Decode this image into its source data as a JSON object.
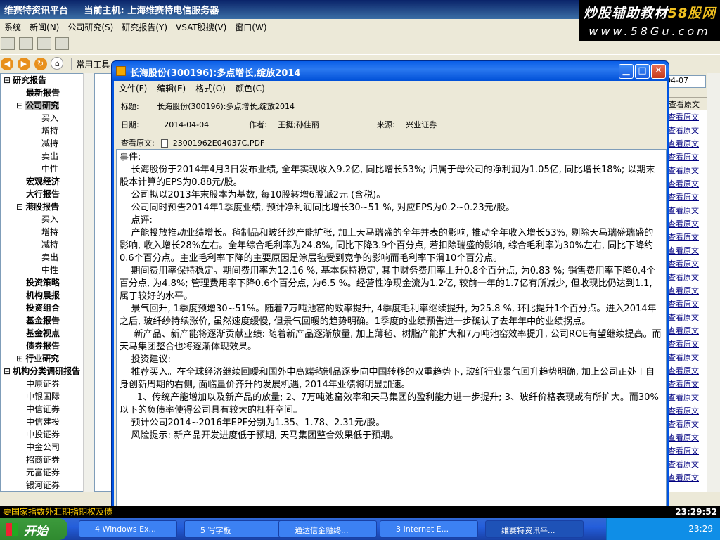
{
  "app": {
    "title": "维赛特资讯平台",
    "host_label": "当前主机: 上海维赛特电信服务器"
  },
  "logo": {
    "line1": "炒股辅助教材",
    "line1_accent": "58股网",
    "line2": "www.58Gu.com"
  },
  "menu": [
    "系统",
    "新闻(N)",
    "公司研究(S)",
    "研究报告(Y)",
    "VSAT股搜(V)",
    "窗口(W)"
  ],
  "toolbar2": {
    "common_tools": "常用工具"
  },
  "tree": [
    {
      "label": "研究报告",
      "level": 0,
      "bold": true,
      "expander": "⊟"
    },
    {
      "label": "最新报告",
      "level": 1,
      "bold": true
    },
    {
      "label": "公司研究",
      "level": 1,
      "bold": true,
      "expander": "⊟",
      "selected": true
    },
    {
      "label": "买入",
      "level": 2
    },
    {
      "label": "增持",
      "level": 2
    },
    {
      "label": "减持",
      "level": 2
    },
    {
      "label": "卖出",
      "level": 2
    },
    {
      "label": "中性",
      "level": 2
    },
    {
      "label": "宏观经济",
      "level": 1,
      "bold": true
    },
    {
      "label": "大行报告",
      "level": 1,
      "bold": true
    },
    {
      "label": "港股报告",
      "level": 1,
      "bold": true,
      "expander": "⊟"
    },
    {
      "label": "买入",
      "level": 2
    },
    {
      "label": "增持",
      "level": 2
    },
    {
      "label": "减持",
      "level": 2
    },
    {
      "label": "卖出",
      "level": 2
    },
    {
      "label": "中性",
      "level": 2
    },
    {
      "label": "投资策略",
      "level": 1,
      "bold": true
    },
    {
      "label": "机构晨报",
      "level": 1,
      "bold": true
    },
    {
      "label": "投资组合",
      "level": 1,
      "bold": true
    },
    {
      "label": "基金报告",
      "level": 1,
      "bold": true
    },
    {
      "label": "基金视点",
      "level": 1,
      "bold": true
    },
    {
      "label": "债券报告",
      "level": 1,
      "bold": true
    },
    {
      "label": "行业研究",
      "level": 1,
      "bold": true,
      "expander": "⊞"
    },
    {
      "label": "机构分类调研报告",
      "level": 0,
      "bold": true,
      "expander": "⊟"
    },
    {
      "label": "中原证券",
      "level": 1
    },
    {
      "label": "中银国际",
      "level": 1
    },
    {
      "label": "中信证券",
      "level": 1
    },
    {
      "label": "中信建投",
      "level": 1
    },
    {
      "label": "中投证券",
      "level": 1
    },
    {
      "label": "中金公司",
      "level": 1
    },
    {
      "label": "招商证券",
      "level": 1
    },
    {
      "label": "元富证券",
      "level": 1
    },
    {
      "label": "银河证券",
      "level": 1
    }
  ],
  "list": {
    "date": "04-07",
    "header": "查看原文",
    "link": "查看原文",
    "rows": 30
  },
  "dialog": {
    "title": "长海股份(300196):多点增长,绽放2014",
    "menu": [
      "文件(F)",
      "编辑(E)",
      "格式(O)",
      "颜色(C)"
    ],
    "meta": {
      "title_label": "标题:",
      "title_value": "长海股份(300196):多点增长,绽放2014",
      "date_label": "日期:",
      "date_value": "2014-04-04",
      "author_label": "作者:",
      "author_value": "王挺;孙佳丽",
      "source_label": "来源:",
      "source_value": "兴业证券",
      "original_label": "查看原文:",
      "original_file": "23001962E04037C.PDF"
    },
    "content": [
      "事件:",
      "    长海股份于2014年4月3日发布业绩, 全年实现收入9.2亿, 同比增长53%; 归属于母公司的净利润为1.05亿, 同比增长18%; 以期末股本计算的EPS为0.88元/股。",
      "    公司拟以2013年末股本为基数, 每10股转增6股派2元 (含税)。",
      "    公司同时预告2014年1季度业绩, 预计净利润同比增长30~51 %, 对应EPS为0.2~0.23元/股。",
      "    点评:",
      "    产能投放推动业绩增长。毡制品和玻纤纱产能扩张, 加上天马瑞盛的全年并表的影响, 推动全年收入增长53%, 剔除天马瑞盛瑞盛的影响, 收入增长28%左右。全年综合毛利率为24.8%, 同比下降3.9个百分点, 若扣除瑞盛的影响, 综合毛利率为30%左右, 同比下降约0.6个百分点。主业毛利率下降的主要原因是涂层毡受到竞争的影响而毛利率下滑10个百分点。",
      "    期间费用率保持稳定。期间费用率为12.16 %, 基本保持稳定, 其中财务费用率上升0.8个百分点, 为0.83 %; 销售费用率下降0.4个百分点, 为4.8%; 管理费用率下降0.6个百分点, 为6.5 %。经营性净现金流为1.2亿, 较前一年的1.7亿有所减少, 但收现比仍达到1.1, 属于较好的水平。",
      "    景气回升, 1季度预增30~51%。随着7万吨池窑的效率提升, 4季度毛利率继续提升, 为25.8 %, 环比提升1个百分点。进入2014年之后, 玻纤纱持续涨价, 虽然速度缓慢, 但景气回暖的趋势明确。1季度的业绩预告进一步确认了去年年中的业绩拐点。",
      "     新产品、新产能将逐渐贡献业绩: 随着新产品逐渐放量, 加上薄毡、树脂产能扩大和7万吨池窑效率提升, 公司ROE有望继续提高。而天马集团整合也将逐渐体现效果。",
      "    投资建议:",
      "    推荐买入。在全球经济继续回暖和国外中高端毡制品逐步向中国转移的双重趋势下, 玻纤行业景气回升趋势明确, 加上公司正处于自身创新周期的右侧, 面临量价齐升的发展机遇, 2014年业绩将明显加速。",
      "      1、传统产能增加以及新产品的放量; 2、7万吨池窑效率和天马集团的盈利能力进一步提升; 3、玻纤价格表现或有所扩大。而30%以下的负债率使得公司具有较大的杠杆空间。",
      "    预计公司2014~2016年EPF分别为1.35、1.78、2.31元/股。",
      "    风险提示: 新产品开发进度低于预期, 天马集团整合效果低于预期。"
    ]
  },
  "ticker": {
    "text": "要国家指数外汇期指期权及债",
    "clock": "23:29:52"
  },
  "taskbar": {
    "start": "开始",
    "tasks": [
      "4 Windows Ex...",
      "5 写字板",
      "通达信金融终...",
      "3 Internet E...",
      "维赛特资讯平..."
    ],
    "clock": "23:29"
  }
}
